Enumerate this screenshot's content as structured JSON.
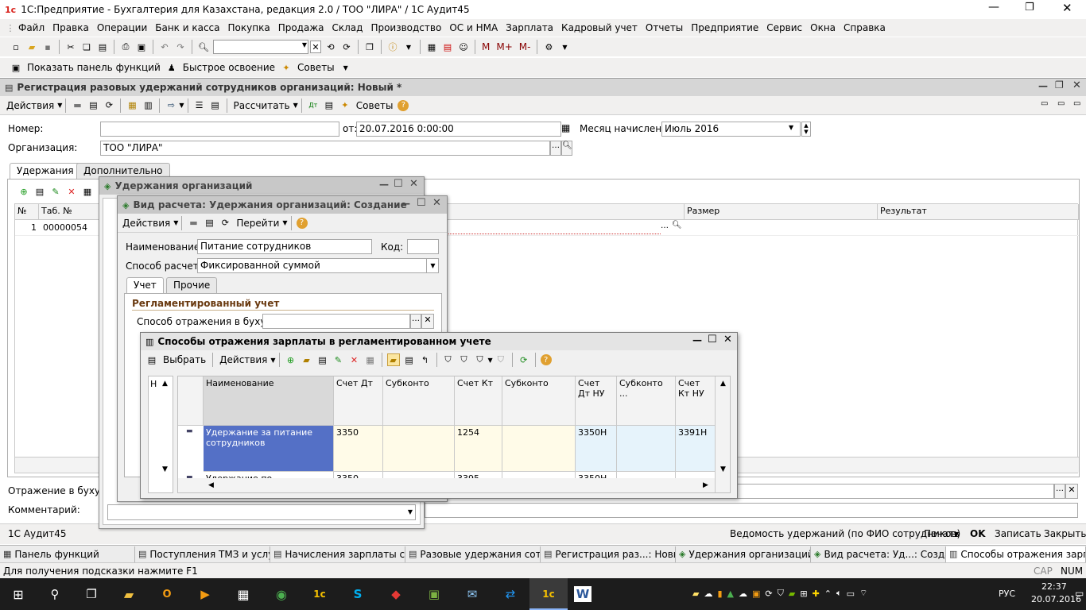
{
  "app": {
    "title": "1С:Предприятие - Бухгалтерия для Казахстана, редакция 2.0 / ТОО \"ЛИРА\" / 1С Аудит45"
  },
  "menu": [
    "Файл",
    "Правка",
    "Операции",
    "Банк и касса",
    "Покупка",
    "Продажа",
    "Склад",
    "Производство",
    "ОС и НМА",
    "Зарплата",
    "Кадровый учет",
    "Отчеты",
    "Предприятие",
    "Сервис",
    "Окна",
    "Справка"
  ],
  "toolbar2": {
    "show_panel": "Показать панель функций",
    "fast_learn": "Быстрое освоение",
    "tips": "Советы",
    "m": "М",
    "mplus": "М+",
    "mminus": "М-"
  },
  "doc": {
    "title": "Регистрация разовых удержаний сотрудников организаций: Новый *",
    "actions": "Действия",
    "calculate": "Рассчитать",
    "tips": "Советы",
    "number_label": "Номер:",
    "number_value": "",
    "from_label": "от:",
    "from_value": "20.07.2016  0:00:00",
    "month_label": "Месяц начисления:",
    "month_value": "Июль 2016",
    "org_label": "Организация:",
    "org_value": "ТОО \"ЛИРА\"",
    "tabs": [
      "Удержания",
      "Дополнительно"
    ],
    "cols": [
      "№",
      "Таб. №",
      "Размер",
      "Результат"
    ],
    "row": {
      "n": "1",
      "tab": "00000054"
    },
    "reflect_label": "Отражение в бухучете",
    "comment_label": "Комментарий:",
    "status_left": "1С Аудит45",
    "bottom": {
      "report": "Ведомость удержаний (по ФИО сотрудников)",
      "print": "Печать",
      "ok": "OK",
      "save": "Записать",
      "close": "Закрыть"
    }
  },
  "w_ud": {
    "title": "Удержания организаций"
  },
  "w_vid": {
    "title": "Вид расчета: Удержания организаций: Создание",
    "actions": "Действия",
    "goto": "Перейти",
    "name_label": "Наименование:",
    "name_value": "Питание сотрудников",
    "code_label": "Код:",
    "code_value": "",
    "method_label": "Способ расчета:",
    "method_value": "Фиксированной суммой",
    "tabs": [
      "Учет",
      "Прочие"
    ],
    "section": "Регламентированный учет",
    "reflect_label": "Способ отражения в бухучете:"
  },
  "w_sp": {
    "title": "Способы отражения зарплаты в регламентированном учете",
    "select": "Выбрать",
    "actions": "Действия",
    "cols": [
      "Наименование",
      "Счет Дт",
      "Субконто",
      "Счет Кт",
      "Субконто",
      "Счет Дт НУ",
      "Субконто ...",
      "Счет Кт НУ"
    ],
    "rows": [
      {
        "name": "Удержание за питание сотрудников",
        "dt": "3350",
        "kt": "1254",
        "dtnu": "3350Н",
        "ktnu": "3391Н"
      },
      {
        "name": "Удержание по",
        "dt": "3350",
        "kt": "3395",
        "dtnu": "3350Н",
        "ktnu": ""
      }
    ]
  },
  "taskbar": [
    "Панель функций",
    "Поступления ТМЗ и услуг",
    "Начисления зарплаты сот...",
    "Разовые удержания сотру...",
    "Регистрация раз...: Новый *",
    "Удержания организаций",
    "Вид расчета: Уд...: Создание",
    "Способы отражения зарпл..."
  ],
  "status": {
    "hint": "Для получения подсказки нажмите F1",
    "cap": "CAP",
    "num": "NUM"
  },
  "os": {
    "lang": "РУС",
    "time": "22:37",
    "date": "20.07.2016"
  }
}
